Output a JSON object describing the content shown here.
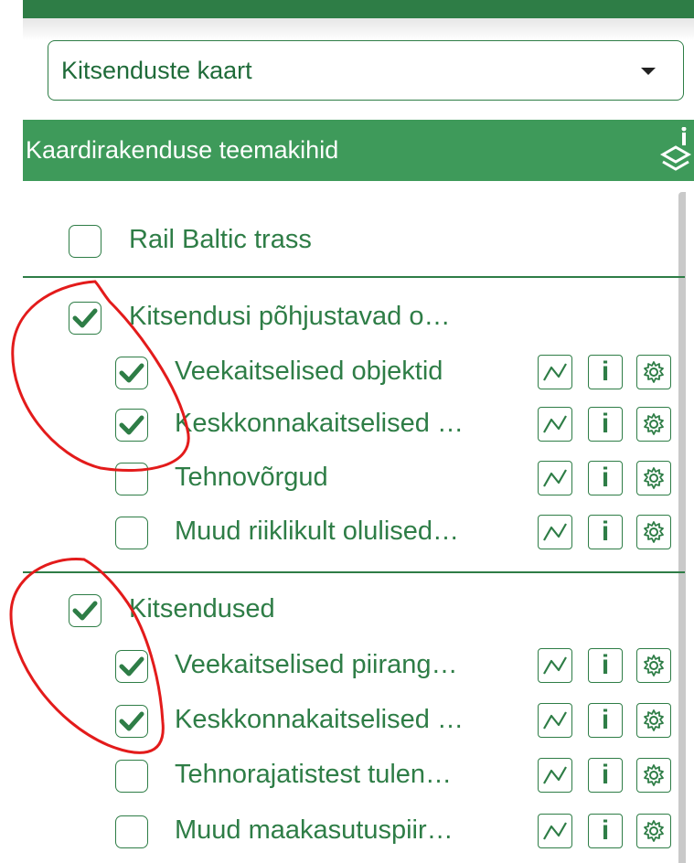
{
  "dropdown": {
    "value": "Kitsenduste kaart",
    "icon": "caret-down-icon"
  },
  "section": {
    "title": "Kaardirakenduse teemakihid",
    "icon": "layers-info-icon"
  },
  "colors": {
    "green": "#2e7d46",
    "header_green": "#3e9a5a",
    "annotation_red": "#e31b1b"
  },
  "tool_icons": [
    "legend-line-icon",
    "info-icon",
    "settings-gear-icon"
  ],
  "tool_info_glyph": "i",
  "layers": {
    "rail": {
      "label": "Rail Baltic trass",
      "checked": false
    },
    "group1": {
      "label": "Kitsendusi põhjustavad o…",
      "checked": true,
      "items": [
        {
          "label": "Veekaitselised objektid",
          "checked": true
        },
        {
          "label": "Keskkonnakaitselised …",
          "checked": true
        },
        {
          "label": "Tehnovõrgud",
          "checked": false
        },
        {
          "label": "Muud riiklikult olulised…",
          "checked": false
        }
      ]
    },
    "group2": {
      "label": "Kitsendused",
      "checked": true,
      "items": [
        {
          "label": "Veekaitselised piirang…",
          "checked": true
        },
        {
          "label": "Keskkonnakaitselised …",
          "checked": true
        },
        {
          "label": "Tehnorajatistest tulen…",
          "checked": false
        },
        {
          "label": "Muud maakasutuspiir…",
          "checked": false
        }
      ]
    }
  }
}
